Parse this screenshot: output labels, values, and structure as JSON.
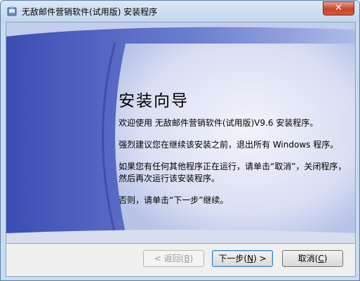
{
  "window": {
    "title": "无敌邮件营销软件(试用版) 安装程序",
    "close_glyph": "✕"
  },
  "main": {
    "heading": "安装向导",
    "welcome": "欢迎使用 无敌邮件营销软件(试用版)V9.6 安装程序。",
    "advice": "强烈建议您在继续该安装之前，退出所有 Windows 程序。",
    "running_programs": "如果您有任何其他程序正在运行，请单击“取消”，关闭程序，然后再次运行该安装程序。",
    "otherwise": "否则，请单击“下一步”继续。"
  },
  "buttons": {
    "back_label": "< 返回(",
    "back_key": "B",
    "back_suffix": ")",
    "next_label": "下一步(",
    "next_key": "N",
    "next_suffix": ") >",
    "cancel_label": "取消(",
    "cancel_key": "C",
    "cancel_suffix": ")"
  },
  "icons": {
    "app": "installer-app-icon",
    "close": "close-icon"
  },
  "colors": {
    "accent_blue": "#3c4fb6",
    "art_light": "#e4e8f7",
    "close_red": "#c7432b"
  }
}
